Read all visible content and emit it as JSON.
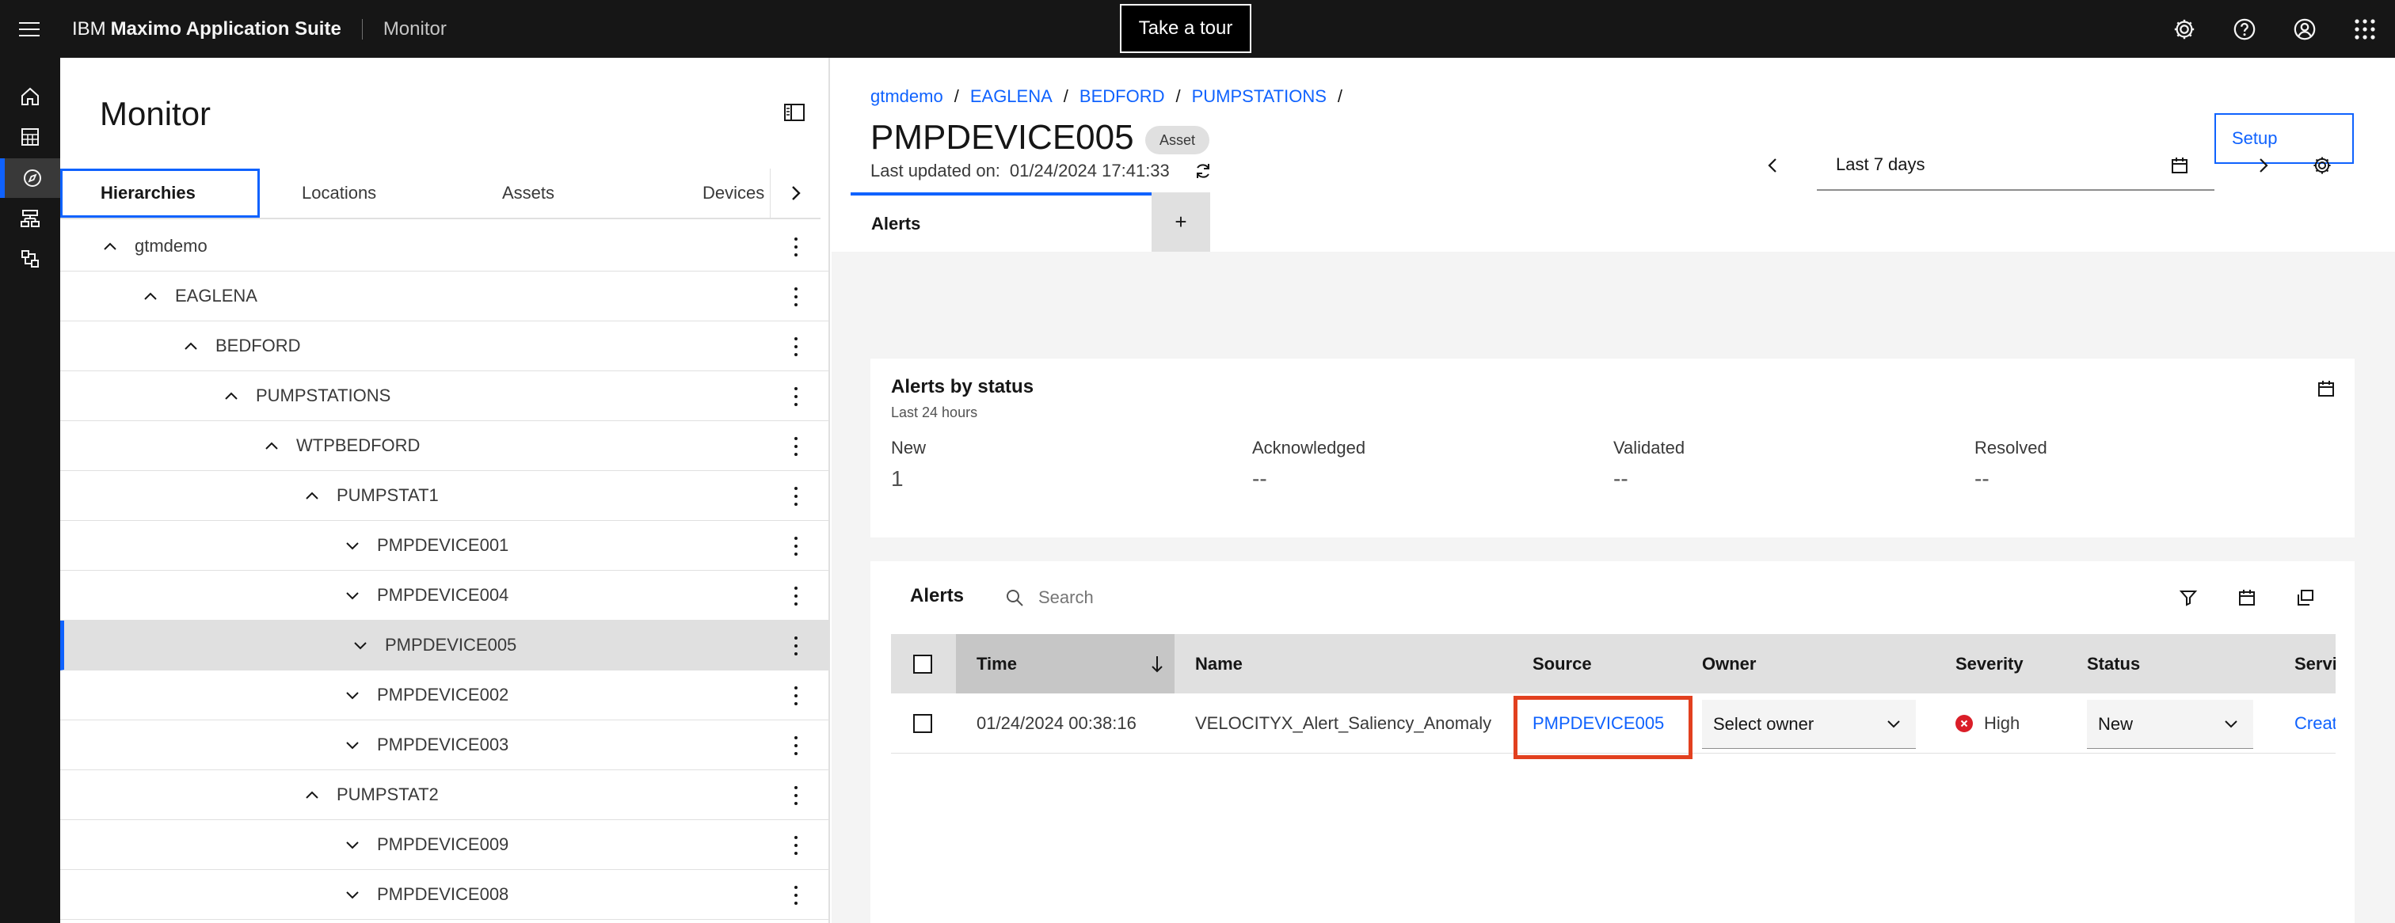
{
  "topbar": {
    "brand_prefix": "IBM",
    "brand_name": "Maximo Application Suite",
    "app_name": "Monitor",
    "tour_label": "Take a tour"
  },
  "panel": {
    "title": "Monitor",
    "tabs": [
      "Hierarchies",
      "Locations",
      "Assets",
      "Devices"
    ],
    "tree": [
      {
        "label": "gtmdemo",
        "level": 0,
        "expanded": true
      },
      {
        "label": "EAGLENA",
        "level": 1,
        "expanded": true
      },
      {
        "label": "BEDFORD",
        "level": 2,
        "expanded": true
      },
      {
        "label": "PUMPSTATIONS",
        "level": 3,
        "expanded": true
      },
      {
        "label": "WTPBEDFORD",
        "level": 4,
        "expanded": true
      },
      {
        "label": "PUMPSTAT1",
        "level": 5,
        "expanded": true
      },
      {
        "label": "PMPDEVICE001",
        "level": 6,
        "expanded": false
      },
      {
        "label": "PMPDEVICE004",
        "level": 6,
        "expanded": false
      },
      {
        "label": "PMPDEVICE005",
        "level": 6,
        "expanded": false,
        "selected": true
      },
      {
        "label": "PMPDEVICE002",
        "level": 6,
        "expanded": false
      },
      {
        "label": "PMPDEVICE003",
        "level": 6,
        "expanded": false
      },
      {
        "label": "PUMPSTAT2",
        "level": 5,
        "expanded": true
      },
      {
        "label": "PMPDEVICE009",
        "level": 6,
        "expanded": false
      },
      {
        "label": "PMPDEVICE008",
        "level": 6,
        "expanded": false
      }
    ]
  },
  "main": {
    "breadcrumbs": [
      "gtmdemo",
      "EAGLENA",
      "BEDFORD",
      "PUMPSTATIONS"
    ],
    "breadcrumb_sep": "/",
    "title": "PMPDEVICE005",
    "tag": "Asset",
    "setup_label": "Setup",
    "tabs": {
      "active": "Alerts",
      "add": "+"
    },
    "last_updated_label": "Last updated on:",
    "last_updated_value": "01/24/2024 17:41:33",
    "date_range": "Last 7 days",
    "status_card": {
      "title": "Alerts by status",
      "subtitle": "Last 24 hours",
      "stats": [
        {
          "label": "New",
          "value": "1"
        },
        {
          "label": "Acknowledged",
          "value": "--"
        },
        {
          "label": "Validated",
          "value": "--"
        },
        {
          "label": "Resolved",
          "value": "--"
        }
      ]
    },
    "alerts": {
      "title": "Alerts",
      "search_placeholder": "Search",
      "columns": [
        "Time",
        "Name",
        "Source",
        "Owner",
        "Severity",
        "Status",
        "Servi"
      ],
      "rows": [
        {
          "time": "01/24/2024 00:38:16",
          "name": "VELOCITYX_Alert_Saliency_Anomaly",
          "source": "PMPDEVICE005",
          "owner": "Select owner",
          "severity": "High",
          "status": "New",
          "service": "Creat"
        }
      ]
    }
  },
  "colors": {
    "accent": "#0f62fe",
    "highlight": "#e2401f",
    "severity_high": "#da1e28"
  }
}
